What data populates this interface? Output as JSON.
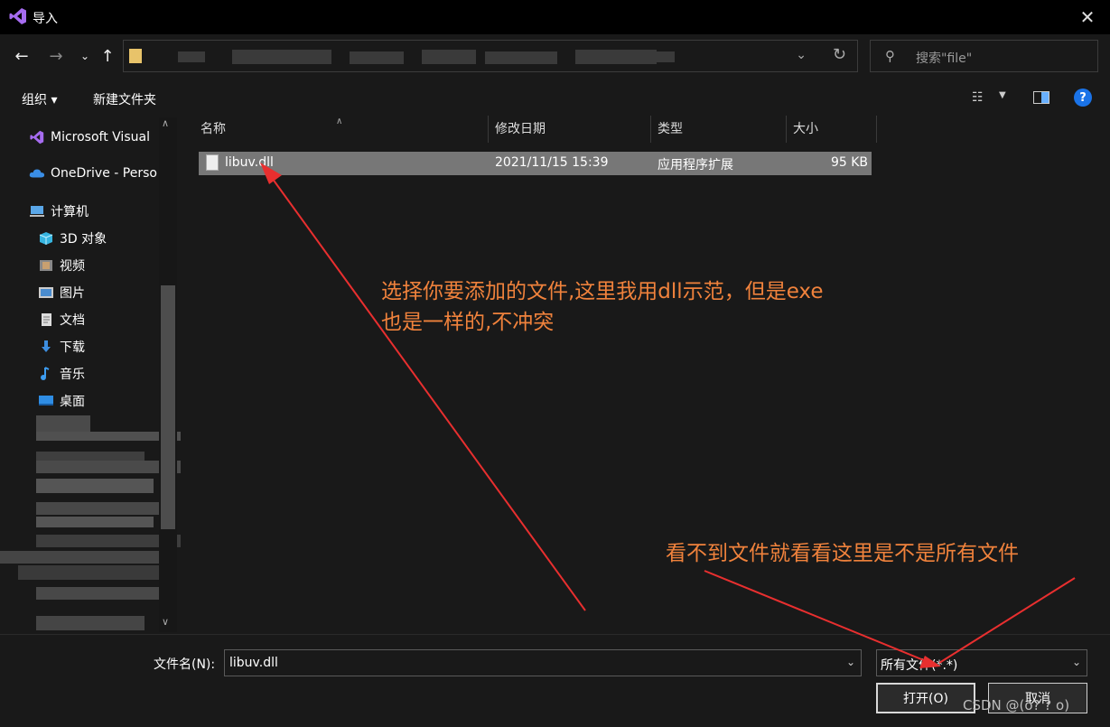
{
  "window": {
    "title": "导入"
  },
  "address": {
    "path": ""
  },
  "search": {
    "placeholder": "搜索\"file\""
  },
  "toolbar": {
    "organize_label": "组织 ▾",
    "new_folder_label": "新建文件夹",
    "help_label": "?"
  },
  "sidebar": {
    "items": [
      {
        "label": "Microsoft Visual",
        "icon": "visual-studio-icon"
      },
      {
        "label": "OneDrive - Perso",
        "icon": "onedrive-icon"
      },
      {
        "label": "计算机",
        "icon": "computer-icon"
      },
      {
        "label": "3D 对象",
        "icon": "3d-objects-icon"
      },
      {
        "label": "视频",
        "icon": "video-icon"
      },
      {
        "label": "图片",
        "icon": "pictures-icon"
      },
      {
        "label": "文档",
        "icon": "documents-icon"
      },
      {
        "label": "下载",
        "icon": "download-icon"
      },
      {
        "label": "音乐",
        "icon": "music-icon"
      },
      {
        "label": "桌面",
        "icon": "desktop-icon"
      }
    ]
  },
  "columns": {
    "name": "名称",
    "modified": "修改日期",
    "type": "类型",
    "size": "大小"
  },
  "files": [
    {
      "name": "libuv.dll",
      "modified": "2021/11/15 15:39",
      "type": "应用程序扩展",
      "size": "95 KB"
    }
  ],
  "annotations": {
    "note1_line1": "选择你要添加的文件,这里我用dll示范，但是exe",
    "note1_line2": "也是一样的,不冲突",
    "note2": "看不到文件就看看这里是不是所有文件",
    "color": "#f0823c"
  },
  "footer": {
    "filename_label": "文件名(N):",
    "filename_value": "libuv.dll",
    "filetype_value": "所有文件(*.*)",
    "open_label": "打开(O)",
    "cancel_label": "取消"
  },
  "watermark": "CSDN @(o? ? o)"
}
